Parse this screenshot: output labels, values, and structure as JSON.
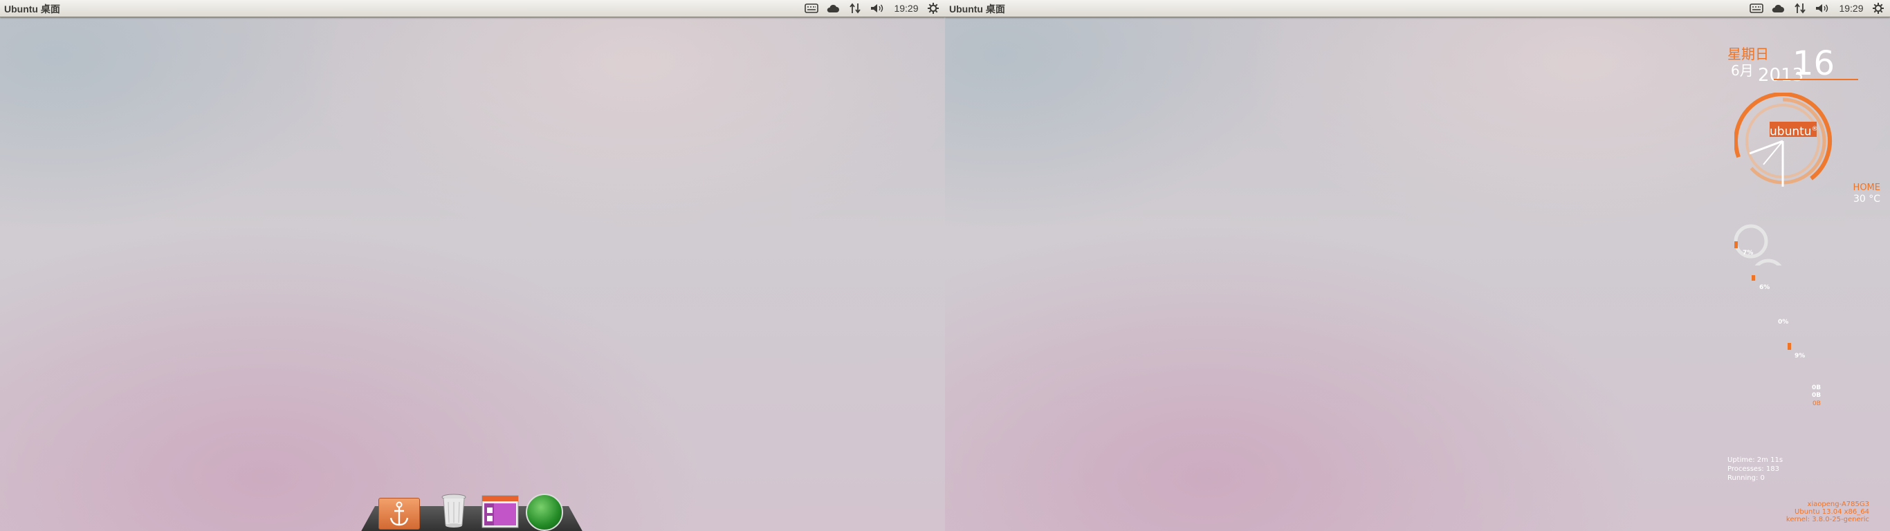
{
  "screens": [
    {
      "panel_title": "Ubuntu 桌面",
      "clock": "19:29"
    },
    {
      "panel_title": "Ubuntu 桌面",
      "clock": "19:29"
    }
  ],
  "indicators": [
    "keyboard-icon",
    "cloud-icon",
    "network-arrows-icon",
    "volume-icon",
    "gear-icon"
  ],
  "dock": {
    "items": [
      "anchor-app-icon",
      "trash-icon",
      "window-app-icon",
      "green-orb-icon"
    ]
  },
  "conky": {
    "weekday": "星期日",
    "month": "6月",
    "year": "2013",
    "day": "16",
    "logo_text": "ubuntu",
    "logo_mark": "®",
    "location": "HOME",
    "temperature": "30 °C",
    "cpu": [
      {
        "pct": "7%",
        "sub": ""
      },
      {
        "pct": "6%",
        "sub": ""
      },
      {
        "pct": "0%",
        "sub": ""
      },
      {
        "pct": "9%",
        "sub": ""
      },
      {
        "pct": "0B",
        "pct2": "0B",
        "sub": "0B"
      }
    ],
    "uptime": "Uptime: 2m 11s",
    "processes": "Processes: 183",
    "running": "Running: 0",
    "hostname": "xiaopeng-A785G3",
    "os": "Ubuntu 13.04  x86_64",
    "kernel": "kernel: 3.8.0-25-generic"
  },
  "colors": {
    "accent": "#f07425",
    "panel_bg": "#e8e6e0"
  }
}
